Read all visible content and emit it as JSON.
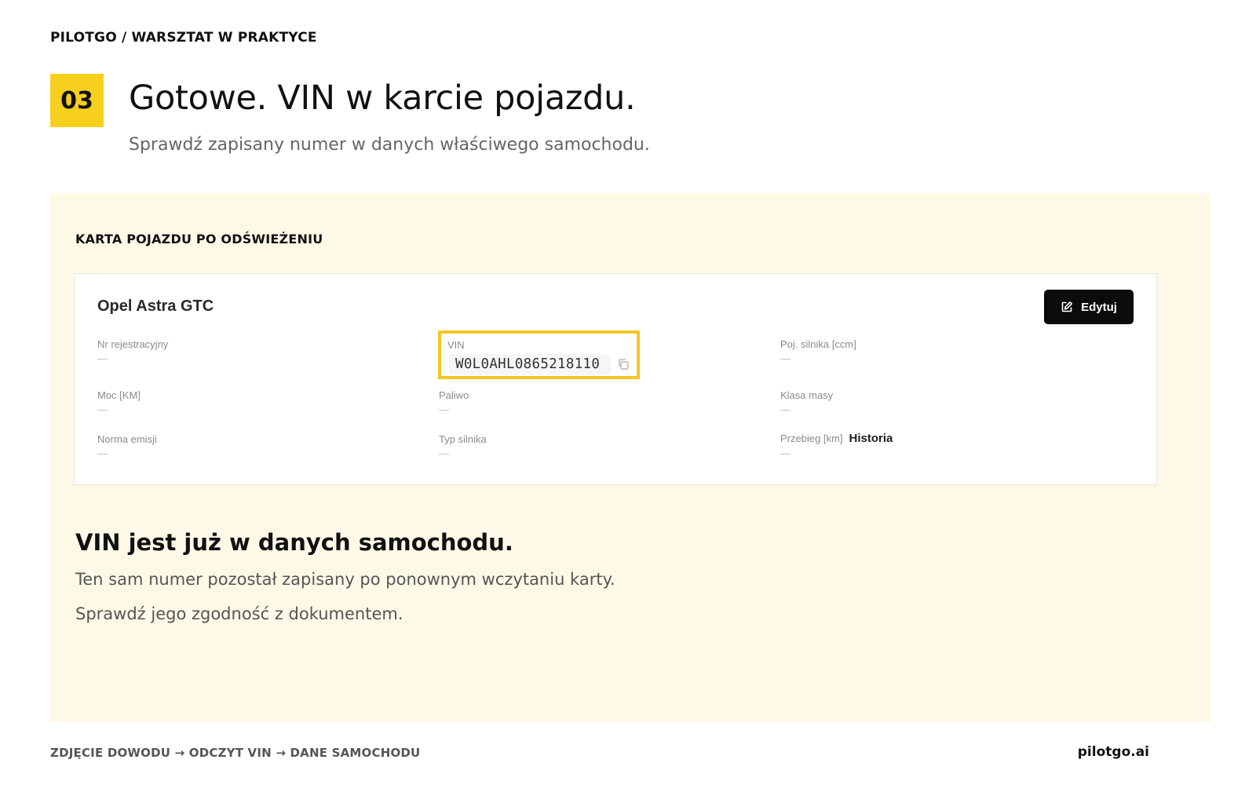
{
  "header": {
    "brand": "PILOTGO / WARSZTAT W PRAKTYCE",
    "step_number": "03",
    "title": "Gotowe. VIN w karcie pojazdu.",
    "subtitle": "Sprawdź zapisany numer w danych właściwego samochodu."
  },
  "panel": {
    "label": "KARTA POJAZDU PO ODŚWIEŻENIU",
    "card": {
      "car_name": "Opel Astra GTC",
      "edit_label": "Edytuj",
      "fields": {
        "registration": {
          "label": "Nr rejestracyjny",
          "value": "—"
        },
        "vin": {
          "label": "VIN",
          "value": "W0L0AHL0865218110"
        },
        "engine_capacity": {
          "label": "Poj. silnika [ccm]",
          "value": "—"
        },
        "power": {
          "label": "Moc [KM]",
          "value": "—"
        },
        "fuel": {
          "label": "Paliwo",
          "value": "—"
        },
        "weight_class": {
          "label": "Klasa masy",
          "value": "—"
        },
        "emission_norm": {
          "label": "Norma emisji",
          "value": "—"
        },
        "engine_type": {
          "label": "Typ silnika",
          "value": "—"
        },
        "mileage": {
          "label": "Przebieg [km]",
          "value": "—",
          "history_link": "Historia"
        }
      }
    },
    "message": {
      "title": "VIN jest już w danych samochodu.",
      "line1": "Ten sam numer pozostał zapisany po ponownym wczytaniu karty.",
      "line2": "Sprawdź jego zgodność z dokumentem."
    }
  },
  "footer": {
    "flow": "ZDJĘCIE DOWODU → ODCZYT VIN → DANE SAMOCHODU",
    "site": "pilotgo.ai"
  },
  "colors": {
    "accent_yellow": "#f7cf1d",
    "panel_bg": "#fef9e7",
    "button_bg": "#0b0b0b"
  },
  "icons": {
    "edit": "edit-icon",
    "copy": "copy-icon"
  }
}
